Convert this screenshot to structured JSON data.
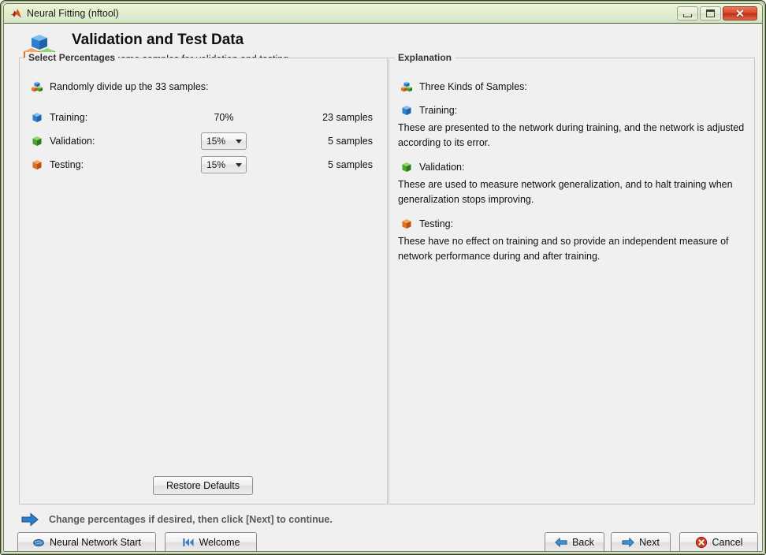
{
  "window": {
    "title": "Neural Fitting (nftool)",
    "logo_icon": "matlab-logo-icon",
    "controls": {
      "minimize": "minimize-icon",
      "maximize": "maximize-icon",
      "close": "✕"
    }
  },
  "header": {
    "icon": "three-cubes-icon",
    "title": "Validation and Test Data",
    "subtitle": "Set aside some samples for validation and testing."
  },
  "left_panel": {
    "group_title": "Select Percentages",
    "lead": {
      "icon": "three-cubes-icon",
      "text": "Randomly divide up the 33 samples:"
    },
    "rows": [
      {
        "icon": "blue-cube-icon",
        "label": "Training:",
        "value": "70%",
        "control": "text",
        "samples": "23 samples"
      },
      {
        "icon": "green-cube-icon",
        "label": "Validation:",
        "value": "15%",
        "control": "dropdown",
        "samples": "5 samples"
      },
      {
        "icon": "orange-cube-icon",
        "label": "Testing:",
        "value": "15%",
        "control": "dropdown",
        "samples": "5 samples"
      }
    ],
    "restore_defaults": "Restore Defaults"
  },
  "right_panel": {
    "group_title": "Explanation",
    "kinds_heading": "Three Kinds of Samples:",
    "kinds_icon": "three-cubes-icon",
    "sections": [
      {
        "icon": "blue-cube-icon",
        "heading": "Training:",
        "body": "These are presented to the network during training, and the network is adjusted according to its error."
      },
      {
        "icon": "green-cube-icon",
        "heading": "Validation:",
        "body": "These are used to measure network generalization, and to halt training when generalization stops improving."
      },
      {
        "icon": "orange-cube-icon",
        "heading": "Testing:",
        "body": "These have no effect on training and so provide an independent measure of network performance during and after training."
      }
    ]
  },
  "status": {
    "icon": "blue-right-arrow-icon",
    "text": "Change percentages if desired, then click [Next] to continue."
  },
  "buttons": {
    "neural_network_start": {
      "label": "Neural Network Start",
      "icon": "brain-icon"
    },
    "welcome": {
      "label": "Welcome",
      "icon": "skip-to-start-icon"
    },
    "back": {
      "label": "Back",
      "icon": "blue-left-arrow-icon"
    },
    "next": {
      "label": "Next",
      "icon": "blue-right-arrow-icon"
    },
    "cancel": {
      "label": "Cancel",
      "icon": "red-x-circle-icon"
    }
  },
  "colors": {
    "titlebar": "#e4edcb",
    "frame": "#5a6b33",
    "panel_bg": "#f0f0f0",
    "training_blue": "#2f7fd0",
    "validation_green": "#4aa52e",
    "testing_orange": "#e4701e",
    "close_red": "#d9442a",
    "status_text": "#5a5a5a"
  }
}
